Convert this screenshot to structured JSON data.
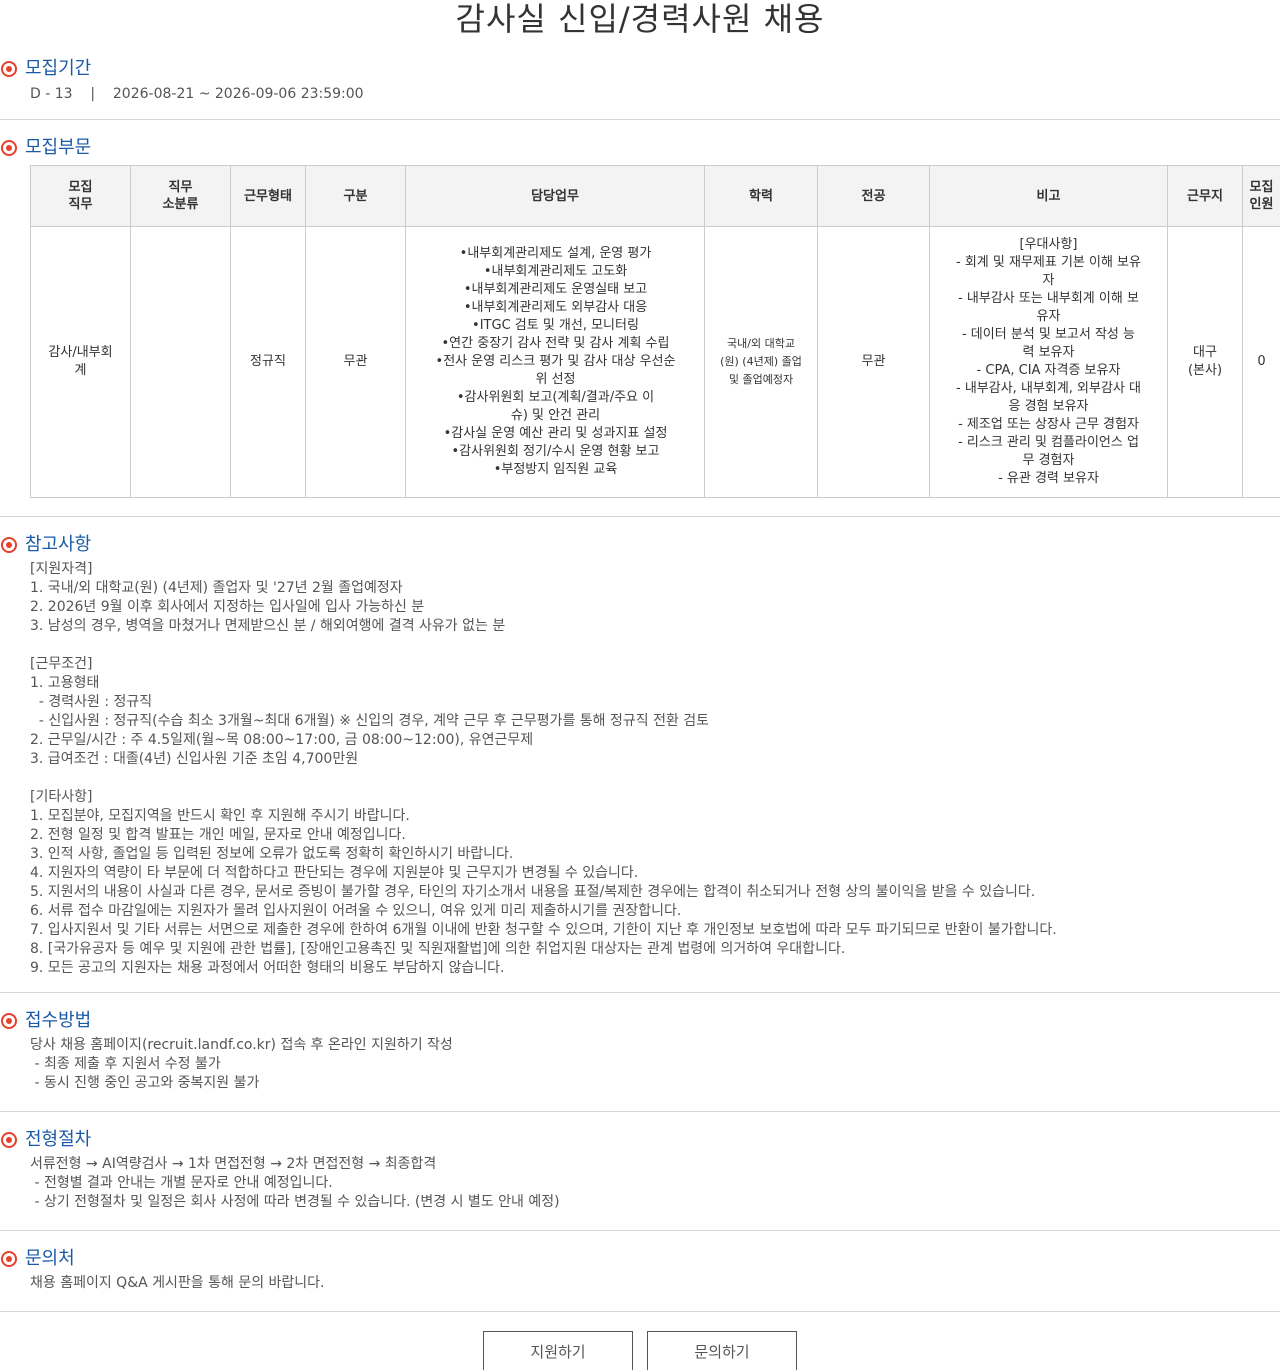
{
  "page_title": "감사실 신입/경력사원 채용",
  "period": {
    "title": "모집기간",
    "dday": "D - 13",
    "separator": "|",
    "range": "2026-08-21 ~ 2026-09-06 23:59:00"
  },
  "division": {
    "title": "모집부문",
    "headers": {
      "job": "모집\n직무",
      "sub": "직무\n소분류",
      "type": "근무형태",
      "category": "구분",
      "duty": "담당업무",
      "education": "학력",
      "major": "전공",
      "note": "비고",
      "location": "근무지",
      "count": "모집\n인원"
    },
    "row": {
      "job": "감사/내부회\n계",
      "sub": "",
      "type": "정규직",
      "category": "무관",
      "duties": [
        "•내부회계관리제도 설계, 운영 평가",
        "•내부회계관리제도 고도화",
        "•내부회계관리제도 운영실태 보고",
        "•내부회계관리제도 외부감사 대응",
        "•ITGC 검토 및 개선, 모니터링",
        "•연간 중장기 감사 전략 및 감사 계획 수립",
        "•전사 운영 리스크 평가 및 감사 대상 우선순\n위 선정",
        "•감사위원회 보고(계획/결과/주요 이\n슈) 및 안건 관리",
        "•감사실 운영 예산 관리 및 성과지표 설정",
        "•감사위원회 정기/수시 운영 현황 보고",
        "•부정방지 임직원 교육"
      ],
      "education": "국내/외 대학교\n(원) (4년제) 졸업\n및 졸업예정자",
      "major": "무관",
      "notes": [
        "[우대사항]",
        "  - 회계 및 재무제표 기본 이해 보유\n자",
        "  - 내부감사 또는 내부회계 이해 보\n유자",
        "  - 데이터 분석 및 보고서 작성 능\n력 보유자",
        "  - CPA, CIA 자격증 보유자",
        "  - 내부감사, 내부회계, 외부감사 대\n응 경험 보유자",
        "  - 제조업 또는 상장사 근무 경험자",
        "  - 리스크 관리 및 컴플라이언스 업\n무 경험자",
        "  - 유관 경력 보유자"
      ],
      "location": "대구\n(본사)",
      "count": "0"
    }
  },
  "reference": {
    "title": "참고사항",
    "lines": [
      "[지원자격]",
      "1. 국내/외 대학교(원) (4년제) 졸업자 및 '27년 2월 졸업예정자",
      "2. 2026년 9월 이후 회사에서 지정하는 입사일에 입사 가능하신 분",
      "3. 남성의 경우, 병역을 마쳤거나 면제받으신 분 / 해외여행에 결격 사유가 없는 분",
      "",
      "[근무조건]",
      "1. 고용형태",
      "  - 경력사원 : 정규직",
      "  - 신입사원 : 정규직(수습 최소 3개월~최대 6개월) ※ 신입의 경우, 계약 근무 후 근무평가를 통해 정규직 전환 검토",
      "2. 근무일/시간 : 주 4.5일제(월~목 08:00~17:00, 금 08:00~12:00), 유연근무제",
      "3. 급여조건 : 대졸(4년) 신입사원 기준 초임 4,700만원",
      "",
      "[기타사항]",
      "1. 모집분야, 모집지역을 반드시 확인 후 지원해 주시기 바랍니다.",
      "2. 전형 일정 및 합격 발표는 개인 메일, 문자로 안내 예정입니다.",
      "3. 인적 사항, 졸업일 등 입력된 정보에 오류가 없도록 정확히 확인하시기 바랍니다.",
      "4. 지원자의 역량이 타 부문에 더 적합하다고 판단되는 경우에 지원분야 및 근무지가 변경될 수 있습니다.",
      "5. 지원서의 내용이 사실과 다른 경우, 문서로 증빙이 불가할 경우, 타인의 자기소개서 내용을 표절/복제한 경우에는 합격이 취소되거나 전형 상의 불이익을 받을 수 있습니다.",
      "6. 서류 접수 마감일에는 지원자가 몰려 입사지원이 어려울 수 있으니, 여유 있게 미리 제출하시기를 권장합니다.",
      "7. 입사지원서 및 기타 서류는 서면으로 제출한 경우에 한하여 6개월 이내에 반환 청구할 수 있으며, 기한이 지난 후 개인정보 보호법에 따라 모두 파기되므로 반환이 불가합니다.",
      "8. [국가유공자 등 예우 및 지원에 관한 법률], [장애인고용촉진 및 직원재활법]에 의한 취업지원 대상자는 관계 법령에 의거하여 우대합니다.",
      "9. 모든 공고의 지원자는 채용 과정에서 어떠한 형태의 비용도 부담하지 않습니다."
    ]
  },
  "apply_method": {
    "title": "접수방법",
    "lines": [
      "당사 채용 홈페이지(recruit.landf.co.kr) 접속 후 온라인 지원하기 작성",
      " - 최종 제출 후 지원서 수정 불가",
      " - 동시 진행 중인 공고와 중복지원 불가"
    ]
  },
  "process": {
    "title": "전형절차",
    "lines": [
      "서류전형 → AI역량검사 → 1차 면접전형 → 2차 면접전형 → 최종합격",
      " - 전형별 결과 안내는 개별 문자로 안내 예정입니다.",
      " - 상기 전형절차 및 일정은 회사 사정에 따라 변경될 수 있습니다. (변경 시 별도 안내 예정)"
    ]
  },
  "contact": {
    "title": "문의처",
    "lines": [
      "채용 홈페이지 Q&A 게시판을 통해 문의 바랍니다."
    ]
  },
  "buttons": {
    "apply": "지원하기",
    "inquiry": "문의하기"
  },
  "colors": {
    "accent_bullet": "#e8402b",
    "section_title": "#1a5aa8",
    "body_text": "#555555",
    "table_header_bg": "#f3f3f3",
    "border": "#cccccc"
  }
}
